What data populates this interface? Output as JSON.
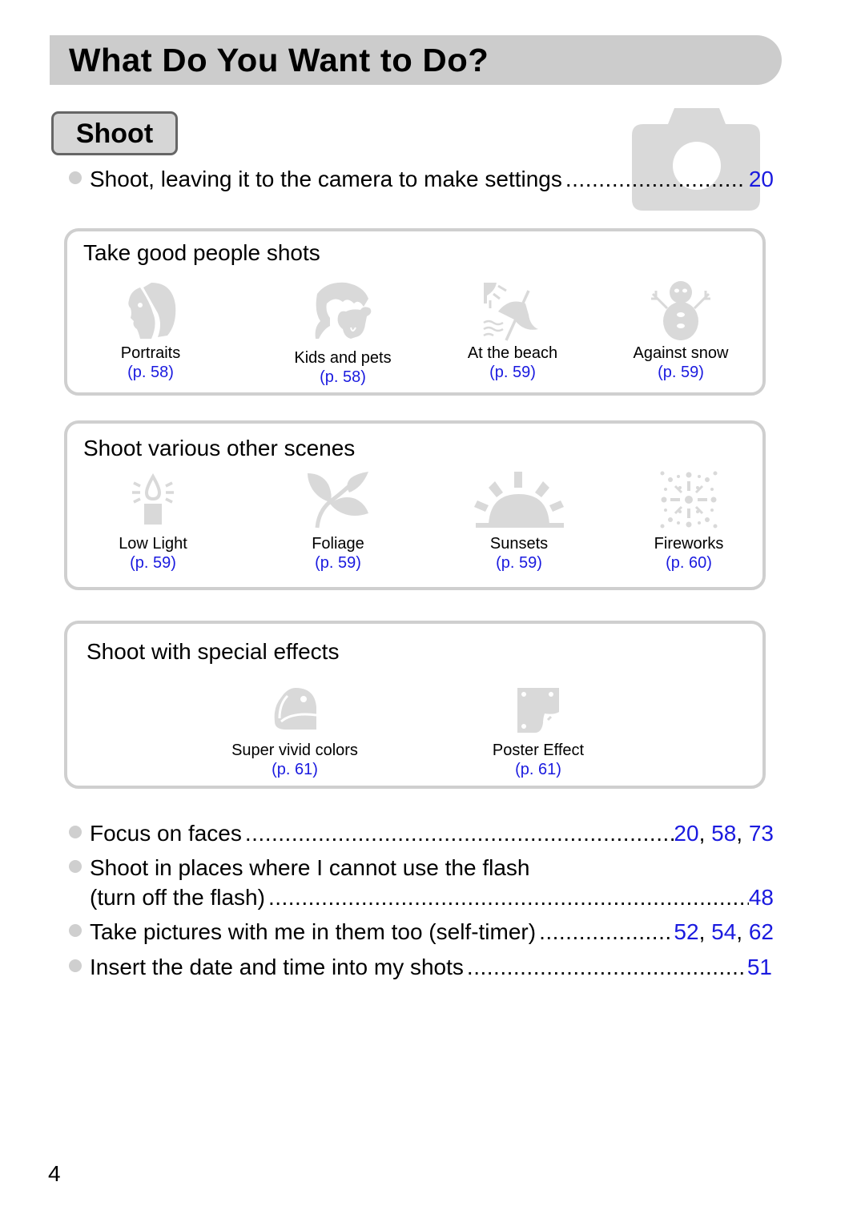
{
  "page": {
    "title": "What Do You Want to Do?",
    "section_tab": "Shoot",
    "page_number": "4"
  },
  "intro_item": {
    "text": "Shoot, leaving it to the camera to make settings",
    "refs": [
      "20"
    ],
    "icon": "camera-icon"
  },
  "panels": [
    {
      "heading": "Take good people shots",
      "scenes": [
        {
          "label": "Portraits",
          "ref": "(p. 58)",
          "icon": "portrait-icon"
        },
        {
          "label": "Kids and pets",
          "ref": "(p. 58)",
          "icon": "kids-and-pets-icon"
        },
        {
          "label": "At the beach",
          "ref": "(p. 59)",
          "icon": "beach-icon"
        },
        {
          "label": "Against snow",
          "ref": "(p. 59)",
          "icon": "snowman-icon"
        }
      ]
    },
    {
      "heading": "Shoot various other scenes",
      "scenes": [
        {
          "label": "Low Light",
          "ref": "(p. 59)",
          "icon": "candle-icon"
        },
        {
          "label": "Foliage",
          "ref": "(p. 59)",
          "icon": "leaf-icon"
        },
        {
          "label": "Sunsets",
          "ref": "(p. 59)",
          "icon": "sunset-icon"
        },
        {
          "label": "Fireworks",
          "ref": "(p. 60)",
          "icon": "fireworks-icon"
        }
      ]
    },
    {
      "heading": "Shoot with special effects",
      "scenes": [
        {
          "label": "Super vivid colors",
          "ref": "(p. 61)",
          "icon": "parrot-icon"
        },
        {
          "label": "Poster Effect",
          "ref": "(p. 61)",
          "icon": "poster-effect-icon"
        }
      ]
    }
  ],
  "index_items": [
    {
      "text": "Focus on faces",
      "refs": [
        "20",
        "58",
        "73"
      ]
    },
    {
      "text": "Shoot in places where I cannot use the flash",
      "continuation": "(turn off the flash)",
      "refs": [
        "48"
      ]
    },
    {
      "text": "Take pictures with me in them too (self-timer)",
      "refs": [
        "52",
        "54",
        "62"
      ]
    },
    {
      "text": "Insert the date and time into my shots",
      "refs": [
        "51"
      ]
    }
  ],
  "colors": {
    "link": "#1a1adf",
    "icon_gray": "#d9d9d9",
    "title_bar": "#cccccc",
    "panel_border": "#cfcfcf"
  }
}
